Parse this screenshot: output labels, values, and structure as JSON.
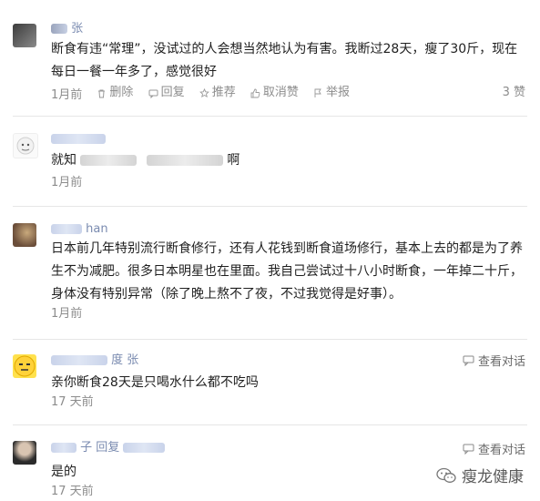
{
  "comments": [
    {
      "user_visible": "张",
      "text": "断食有违“常理”，没试过的人会想当然地认为有害。我断过28天，瘦了30斤，现在每日一餐一年多了，感觉很好",
      "time": "1月前",
      "actions": [
        "删除",
        "回复",
        "推荐",
        "取消赞",
        "举报"
      ],
      "likes": "3 赞"
    },
    {
      "text_start": "就知",
      "text_end": "啊",
      "time": "1月前"
    },
    {
      "user_visible": "han",
      "text": "日本前几年特别流行断食修行，还有人花钱到断食道场修行，基本上去的都是为了养生不为减肥。很多日本明星也在里面。我自己尝试过十八小时断食，一年掉二十斤，身体没有特别异常（除了晚上熬不了夜，不过我觉得是好事）。",
      "time": "1月前"
    },
    {
      "user_visible": "度 张",
      "text": "亲你断食28天是只喝水什么都不吃吗",
      "time": "17 天前",
      "dialog": "查看对话"
    },
    {
      "user_visible": "子 回复",
      "text": "是的",
      "time": "17 天前",
      "dialog": "查看对话"
    }
  ],
  "watermark": "瘦龙健康",
  "colors": {
    "username": "#7a8bb0",
    "meta": "#8c8c8c",
    "divider": "#e6e6e6"
  }
}
